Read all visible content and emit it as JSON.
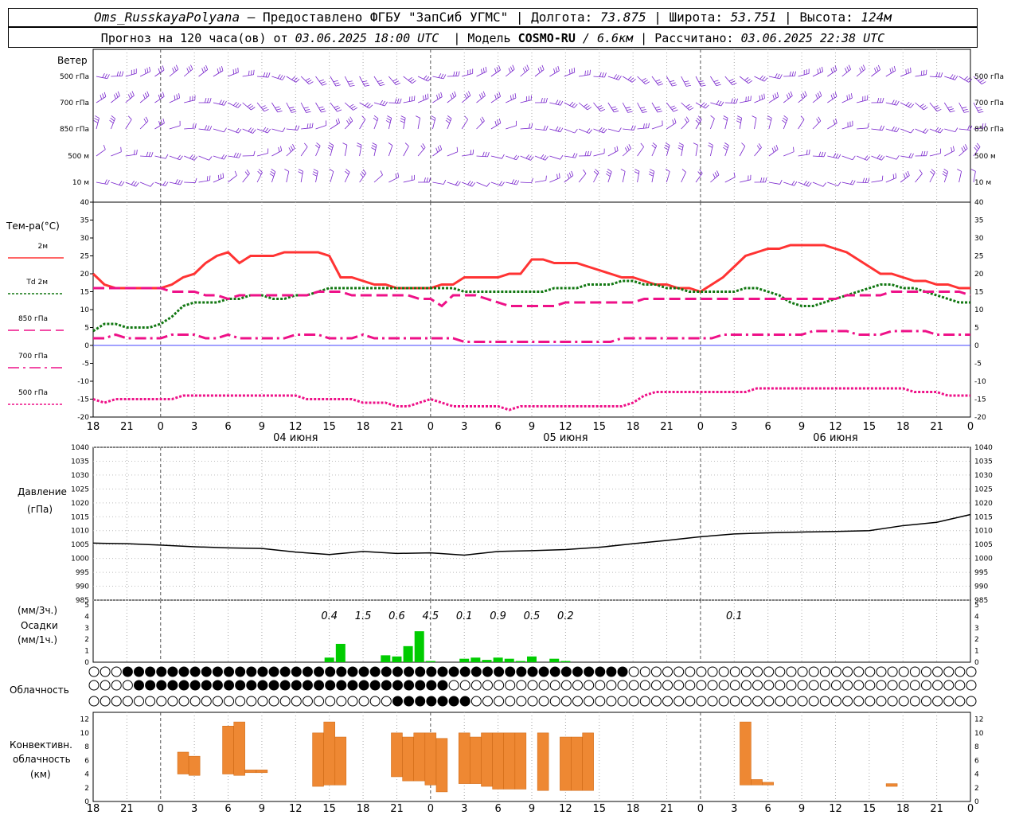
{
  "header": {
    "station": "Oms_RusskayaPolyana",
    "sep": " – ",
    "provider": "Предоставлено ФГБУ \"ЗапСиб УГМС\"",
    "lon_label": "Долгота:",
    "lon": "73.875",
    "lat_label": "Широта:",
    "lat": "53.751",
    "alt_label": "Высота:",
    "alt": "124м",
    "forecast_prefix": "Прогноз на 120 часа(ов) от",
    "forecast_start": "03.06.2025 18:00 UTC",
    "model_label": "Модель",
    "model": "COSMO-RU",
    "model_res": "/ 6.6км",
    "calc_label": "Рассчитано:",
    "calc": "03.06.2025 22:38 UTC"
  },
  "time_axis": {
    "start_hour": 18,
    "hours_total": 78,
    "tick_labels": [
      "18",
      "21",
      "0",
      "3",
      "6",
      "9",
      "12",
      "15",
      "18",
      "21",
      "0",
      "3",
      "6",
      "9",
      "12",
      "15",
      "18",
      "21",
      "0",
      "3",
      "6",
      "9",
      "12",
      "15",
      "18",
      "21",
      "0"
    ],
    "dates": [
      {
        "hour": 18,
        "label": "04 июня"
      },
      {
        "hour": 42,
        "label": "05 июня"
      },
      {
        "hour": 66,
        "label": "06 июня"
      }
    ]
  },
  "wind": {
    "title": "Ветер",
    "levels": [
      "500 гПа",
      "700 гПа",
      "850 гПа",
      "500 м",
      "10 м"
    ]
  },
  "temperature": {
    "title": "Тем-ра(°С)",
    "legend": [
      {
        "label": "2м",
        "color": "#ff3333",
        "style": "solid"
      },
      {
        "label": "Td  2м",
        "color": "#117711",
        "style": "dotted"
      },
      {
        "label": "850 гПа",
        "color": "#ee1188",
        "style": "dash"
      },
      {
        "label": "700 гПа",
        "color": "#ee1188",
        "style": "dashdot"
      },
      {
        "label": "500 гПа",
        "color": "#ee1188",
        "style": "dot"
      }
    ],
    "ticks": [
      "40",
      "35",
      "30",
      "25",
      "20",
      "15",
      "10",
      "5",
      "0",
      "-5",
      "-10",
      "-15",
      "-20"
    ]
  },
  "pressure": {
    "title": "Давление",
    "unit": "(гПа)",
    "ticks": [
      "1040",
      "1035",
      "1030",
      "1025",
      "1020",
      "1015",
      "1010",
      "1005",
      "1000",
      "995",
      "990",
      "985"
    ]
  },
  "precip": {
    "title": "Осадки",
    "unit3": "(мм/3ч.)",
    "unit1": "(мм/1ч.)",
    "ticks": [
      "5",
      "4",
      "3",
      "2",
      "1",
      "0"
    ],
    "totals": [
      {
        "hour": 21,
        "text": "0.4"
      },
      {
        "hour": 24,
        "text": "1.5"
      },
      {
        "hour": 27,
        "text": "0.6"
      },
      {
        "hour": 30,
        "text": "4.5"
      },
      {
        "hour": 33,
        "text": "0.1"
      },
      {
        "hour": 36,
        "text": "0.9"
      },
      {
        "hour": 39,
        "text": "0.5"
      },
      {
        "hour": 42,
        "text": "0.2"
      },
      {
        "hour": 57,
        "text": "0.1"
      }
    ]
  },
  "clouds": {
    "title": "Облачность"
  },
  "convective": {
    "title1": "Конвективн.",
    "title2": "облачность",
    "unit": "(км)",
    "ticks": [
      "12",
      "10",
      "8",
      "6",
      "4",
      "2",
      "0"
    ]
  },
  "chart_data": [
    {
      "type": "line",
      "title": "Тем-ра(°С)",
      "x": [
        0,
        1,
        2,
        3,
        4,
        5,
        6,
        7,
        8,
        9,
        10,
        11,
        12,
        13,
        14,
        15,
        16,
        17,
        18,
        19,
        20,
        21,
        22,
        23,
        24,
        25,
        26,
        27,
        28,
        29,
        30,
        31,
        32,
        33,
        34,
        35,
        36,
        37,
        38,
        39,
        40,
        41,
        42,
        43,
        44,
        45,
        46,
        47,
        48,
        49,
        50,
        51,
        52,
        53,
        54,
        55,
        56,
        57,
        58,
        59,
        60,
        61,
        62,
        63,
        64,
        65,
        66,
        67,
        68,
        69,
        70,
        71,
        72,
        73,
        74,
        75,
        76,
        77,
        78
      ],
      "ylim": [
        -20,
        40
      ],
      "series": [
        {
          "name": "2м",
          "color": "#ff3333",
          "style": "solid",
          "values": [
            20,
            17,
            16,
            16,
            16,
            16,
            16,
            17,
            19,
            20,
            23,
            25,
            26,
            23,
            25,
            25,
            25,
            26,
            26,
            26,
            26,
            25,
            19,
            19,
            18,
            17,
            17,
            16,
            16,
            16,
            16,
            17,
            17,
            19,
            19,
            19,
            19,
            20,
            20,
            24,
            24,
            23,
            23,
            23,
            22,
            21,
            20,
            19,
            19,
            18,
            17,
            17,
            16,
            16,
            15,
            17,
            19,
            22,
            25,
            26,
            27,
            27,
            28,
            28,
            28,
            28,
            27,
            26,
            24,
            22,
            20,
            20,
            19,
            18,
            18,
            17,
            17,
            16,
            16
          ]
        },
        {
          "name": "Td  2м",
          "color": "#117711",
          "style": "dotted",
          "values": [
            4,
            6,
            6,
            5,
            5,
            5,
            6,
            8,
            11,
            12,
            12,
            12,
            13,
            13,
            14,
            14,
            13,
            13,
            14,
            14,
            15,
            16,
            16,
            16,
            16,
            16,
            16,
            16,
            16,
            16,
            16,
            16,
            16,
            15,
            15,
            15,
            15,
            15,
            15,
            15,
            15,
            16,
            16,
            16,
            17,
            17,
            17,
            18,
            18,
            17,
            17,
            16,
            16,
            15,
            15,
            15,
            15,
            15,
            16,
            16,
            15,
            14,
            12,
            11,
            11,
            12,
            13,
            14,
            15,
            16,
            17,
            17,
            16,
            16,
            15,
            14,
            13,
            12,
            12
          ]
        },
        {
          "name": "850 гПа",
          "color": "#ee1188",
          "style": "dash",
          "values": [
            16,
            16,
            16,
            16,
            16,
            16,
            16,
            15,
            15,
            15,
            14,
            14,
            13,
            14,
            14,
            14,
            14,
            14,
            14,
            14,
            15,
            15,
            15,
            14,
            14,
            14,
            14,
            14,
            14,
            13,
            13,
            11,
            14,
            14,
            14,
            13,
            12,
            11,
            11,
            11,
            11,
            11,
            12,
            12,
            12,
            12,
            12,
            12,
            12,
            13,
            13,
            13,
            13,
            13,
            13,
            13,
            13,
            13,
            13,
            13,
            13,
            13,
            13,
            13,
            13,
            13,
            13,
            14,
            14,
            14,
            14,
            15,
            15,
            15,
            15,
            15,
            15,
            15,
            14
          ]
        },
        {
          "name": "700 гПа",
          "color": "#ee1188",
          "style": "dashdot",
          "values": [
            2,
            2,
            3,
            2,
            2,
            2,
            2,
            3,
            3,
            3,
            2,
            2,
            3,
            2,
            2,
            2,
            2,
            2,
            3,
            3,
            3,
            2,
            2,
            2,
            3,
            2,
            2,
            2,
            2,
            2,
            2,
            2,
            2,
            1,
            1,
            1,
            1,
            1,
            1,
            1,
            1,
            1,
            1,
            1,
            1,
            1,
            1,
            2,
            2,
            2,
            2,
            2,
            2,
            2,
            2,
            2,
            3,
            3,
            3,
            3,
            3,
            3,
            3,
            3,
            4,
            4,
            4,
            4,
            3,
            3,
            3,
            4,
            4,
            4,
            4,
            3,
            3,
            3,
            3
          ]
        },
        {
          "name": "500 гПа",
          "color": "#ee1188",
          "style": "dot",
          "values": [
            -15,
            -16,
            -15,
            -15,
            -15,
            -15,
            -15,
            -15,
            -14,
            -14,
            -14,
            -14,
            -14,
            -14,
            -14,
            -14,
            -14,
            -14,
            -14,
            -15,
            -15,
            -15,
            -15,
            -15,
            -16,
            -16,
            -16,
            -17,
            -17,
            -16,
            -15,
            -16,
            -17,
            -17,
            -17,
            -17,
            -17,
            -18,
            -17,
            -17,
            -17,
            -17,
            -17,
            -17,
            -17,
            -17,
            -17,
            -17,
            -16,
            -14,
            -13,
            -13,
            -13,
            -13,
            -13,
            -13,
            -13,
            -13,
            -13,
            -12,
            -12,
            -12,
            -12,
            -12,
            -12,
            -12,
            -12,
            -12,
            -12,
            -12,
            -12,
            -12,
            -12,
            -13,
            -13,
            -13,
            -14,
            -14,
            -14
          ]
        }
      ]
    },
    {
      "type": "line",
      "title": "Давление",
      "x": [
        0,
        3,
        6,
        9,
        12,
        15,
        18,
        21,
        24,
        27,
        30,
        33,
        36,
        39,
        42,
        45,
        48,
        51,
        54,
        57,
        60,
        63,
        66,
        69,
        72,
        75,
        78
      ],
      "ylim": [
        985,
        1040
      ],
      "series": [
        {
          "name": "Давление",
          "color": "#000000",
          "values": [
            1005.5,
            1005.3,
            1004.8,
            1004.2,
            1003.8,
            1003.6,
            1002.3,
            1001.4,
            1002.5,
            1001.8,
            1002.0,
            1001.2,
            1002.5,
            1002.8,
            1003.2,
            1004.0,
            1005.3,
            1006.5,
            1007.8,
            1008.8,
            1009.2,
            1009.5,
            1009.7,
            1010.0,
            1011.8,
            1013.0,
            1015.8
          ]
        }
      ]
    },
    {
      "type": "bar",
      "title": "Осадки",
      "x": [
        21,
        22,
        26,
        27,
        28,
        29,
        30,
        33,
        34,
        35,
        36,
        37,
        38,
        39,
        41,
        42
      ],
      "ylim": [
        0,
        5
      ],
      "series": [
        {
          "name": "Осадки",
          "color": "#00cc00",
          "values": [
            0.4,
            1.6,
            0.6,
            0.5,
            1.4,
            2.7,
            0.1,
            0.3,
            0.4,
            0.2,
            0.4,
            0.3,
            0.1,
            0.5,
            0.3,
            0.1
          ]
        }
      ]
    },
    {
      "type": "bar",
      "title": "Конвективн. облачность",
      "ylim": [
        0,
        13
      ],
      "bars": [
        {
          "x": 8,
          "bottom": 4.0,
          "top": 7.2
        },
        {
          "x": 9,
          "bottom": 3.8,
          "top": 6.6
        },
        {
          "x": 12,
          "bottom": 4.0,
          "top": 11.0
        },
        {
          "x": 13,
          "bottom": 3.8,
          "top": 11.6
        },
        {
          "x": 14,
          "bottom": 4.2,
          "top": 4.6
        },
        {
          "x": 15,
          "bottom": 4.2,
          "top": 4.6
        },
        {
          "x": 20,
          "bottom": 2.2,
          "top": 10.0
        },
        {
          "x": 21,
          "bottom": 2.4,
          "top": 11.6
        },
        {
          "x": 22,
          "bottom": 2.4,
          "top": 9.4
        },
        {
          "x": 27,
          "bottom": 3.6,
          "top": 10.0
        },
        {
          "x": 28,
          "bottom": 3.0,
          "top": 9.4
        },
        {
          "x": 29,
          "bottom": 3.0,
          "top": 10.0
        },
        {
          "x": 30,
          "bottom": 2.4,
          "top": 10.0
        },
        {
          "x": 31,
          "bottom": 1.4,
          "top": 9.2
        },
        {
          "x": 33,
          "bottom": 2.6,
          "top": 10.0
        },
        {
          "x": 34,
          "bottom": 2.6,
          "top": 9.4
        },
        {
          "x": 35,
          "bottom": 2.2,
          "top": 10.0
        },
        {
          "x": 36,
          "bottom": 1.8,
          "top": 10.0
        },
        {
          "x": 37,
          "bottom": 1.8,
          "top": 10.0
        },
        {
          "x": 38,
          "bottom": 1.8,
          "top": 10.0
        },
        {
          "x": 40,
          "bottom": 1.6,
          "top": 10.0
        },
        {
          "x": 42,
          "bottom": 1.6,
          "top": 9.4
        },
        {
          "x": 43,
          "bottom": 1.6,
          "top": 9.4
        },
        {
          "x": 44,
          "bottom": 1.6,
          "top": 10.0
        },
        {
          "x": 58,
          "bottom": 2.4,
          "top": 11.6
        },
        {
          "x": 59,
          "bottom": 2.4,
          "top": 3.2
        },
        {
          "x": 60,
          "bottom": 2.4,
          "top": 2.8
        },
        {
          "x": 71,
          "bottom": 2.2,
          "top": 2.6
        }
      ]
    }
  ]
}
